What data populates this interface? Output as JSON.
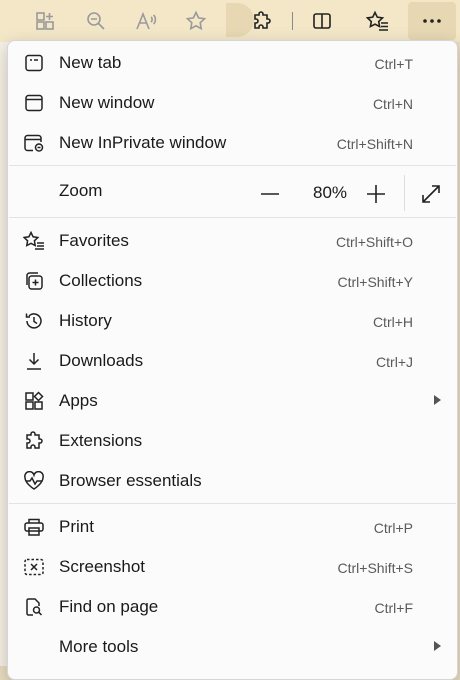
{
  "toolbar": {
    "icons": [
      "add-tab-group-icon",
      "zoom-out-icon",
      "read-aloud-icon",
      "favorite-star-icon",
      "extensions-icon",
      "split-screen-icon",
      "favorites-list-icon",
      "more-options-icon"
    ],
    "accent": "#f3e7c8"
  },
  "menu": {
    "items": [
      {
        "label": "New tab",
        "shortcut": "Ctrl+T",
        "icon": "new-tab-icon"
      },
      {
        "label": "New window",
        "shortcut": "Ctrl+N",
        "icon": "new-window-icon"
      },
      {
        "label": "New InPrivate window",
        "shortcut": "Ctrl+Shift+N",
        "icon": "inprivate-window-icon"
      }
    ],
    "zoom": {
      "label": "Zoom",
      "value": "80%",
      "minus": "−",
      "plus": "+"
    },
    "items2": [
      {
        "label": "Favorites",
        "shortcut": "Ctrl+Shift+O",
        "icon": "favorites-icon"
      },
      {
        "label": "Collections",
        "shortcut": "Ctrl+Shift+Y",
        "icon": "collections-icon"
      },
      {
        "label": "History",
        "shortcut": "Ctrl+H",
        "icon": "history-icon"
      },
      {
        "label": "Downloads",
        "shortcut": "Ctrl+J",
        "icon": "downloads-icon"
      },
      {
        "label": "Apps",
        "shortcut": "",
        "icon": "apps-icon",
        "submenu": true
      },
      {
        "label": "Extensions",
        "shortcut": "",
        "icon": "extensions-icon"
      },
      {
        "label": "Browser essentials",
        "shortcut": "",
        "icon": "browser-essentials-icon"
      }
    ],
    "items3": [
      {
        "label": "Print",
        "shortcut": "Ctrl+P",
        "icon": "print-icon"
      },
      {
        "label": "Screenshot",
        "shortcut": "Ctrl+Shift+S",
        "icon": "screenshot-icon"
      },
      {
        "label": "Find on page",
        "shortcut": "Ctrl+F",
        "icon": "find-on-page-icon"
      },
      {
        "label": "More tools",
        "shortcut": "",
        "icon": "more-tools-icon",
        "submenu": true
      }
    ]
  }
}
